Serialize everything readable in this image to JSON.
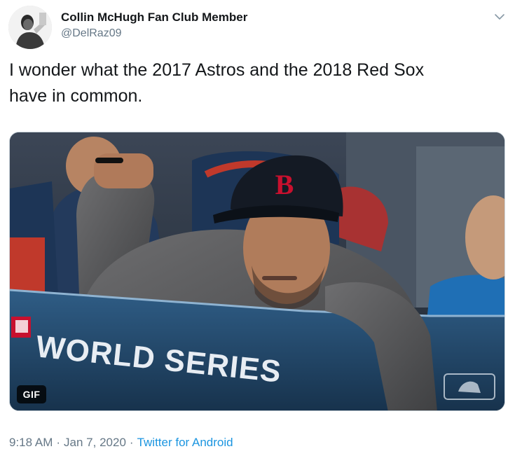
{
  "author": {
    "display_name": "Collin McHugh Fan Club Member",
    "handle": "@DelRaz09",
    "avatar": "avatar-photo"
  },
  "menu": {
    "icon": "chevron-down-icon"
  },
  "tweet": {
    "text": "I wonder what the 2017 Astros and the 2018 Red Sox\nhave in common."
  },
  "media": {
    "badge": "GIF",
    "banner_text": "WORLD SERIES",
    "cap_logo": "B",
    "watermark_icon": "mlb-logo-icon"
  },
  "meta": {
    "time": "9:18 AM",
    "date": "Jan 7, 2020",
    "separator": "·",
    "source": "Twitter for Android"
  },
  "colors": {
    "text": "#14171a",
    "secondary": "#657786",
    "link": "#1b95e0"
  }
}
